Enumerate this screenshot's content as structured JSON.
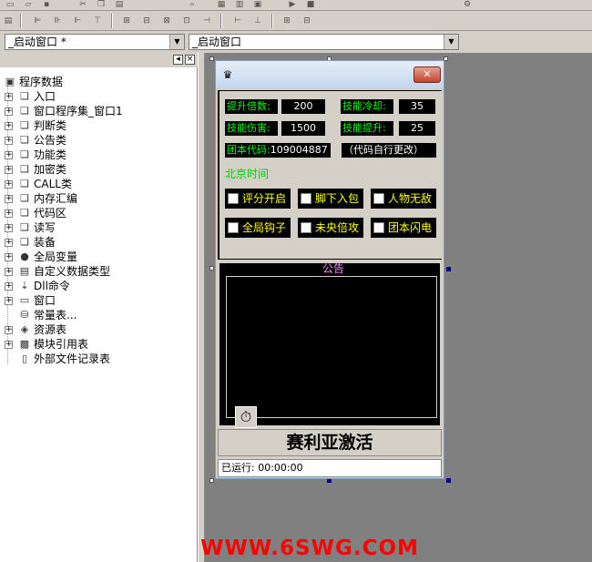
{
  "combo": {
    "left_value": "_启动窗口 *",
    "right_value": "_启动窗口"
  },
  "tree_panel": {
    "pin_glyph": "◂",
    "close_glyph": "×",
    "items": [
      {
        "label": "程序数据",
        "icon": "program-data-icon"
      },
      {
        "label": "入口",
        "icon": "book-icon"
      },
      {
        "label": "窗口程序集_窗口1",
        "icon": "book-icon"
      },
      {
        "label": "判断类",
        "icon": "book-icon"
      },
      {
        "label": "公告类",
        "icon": "book-icon"
      },
      {
        "label": "功能类",
        "icon": "book-icon"
      },
      {
        "label": "加密类",
        "icon": "book-icon"
      },
      {
        "label": "CALL类",
        "icon": "book-icon"
      },
      {
        "label": "内存汇编",
        "icon": "book-icon"
      },
      {
        "label": "代码区",
        "icon": "book-icon"
      },
      {
        "label": "读写",
        "icon": "book-icon"
      },
      {
        "label": "装备",
        "icon": "book-icon"
      },
      {
        "label": "全局变量",
        "icon": "global-var-icon"
      },
      {
        "label": "自定义数据类型",
        "icon": "datatype-icon"
      },
      {
        "label": "Dll命令",
        "icon": "dll-icon"
      },
      {
        "label": "窗口",
        "icon": "window-icon"
      },
      {
        "label": "常量表...",
        "icon": "constant-icon"
      },
      {
        "label": "资源表",
        "icon": "resource-icon"
      },
      {
        "label": "模块引用表",
        "icon": "module-icon"
      },
      {
        "label": "外部文件记录表",
        "icon": "file-record-icon"
      }
    ]
  },
  "form": {
    "close_glyph": "✕",
    "app_icon_glyph": "♛",
    "fields": {
      "boost_label": "提升倍数:",
      "boost_value": "200",
      "cooldown_label": "技能冷却:",
      "cooldown_value": "35",
      "damage_label": "技能伤害:",
      "damage_value": "1500",
      "skill_boost_label": "技能提升:",
      "skill_boost_value": "25",
      "team_code_label": "团本代码:",
      "team_code_value": "109004887",
      "team_code_note": "（代码自行更改）",
      "beijing_time": "北京时间"
    },
    "checkboxes": [
      "评分开启",
      "脚下入包",
      "人物无敌",
      "全局钩子",
      "未央倍攻",
      "团本闪电"
    ],
    "notice_title": "公告",
    "activate_label": "赛利亚激活",
    "status_text": "已运行: 00:00:00",
    "stopwatch_glyph": "⏱"
  },
  "watermark": "WWW.6SWG.COM",
  "colors": {
    "label_green": "#00ff00",
    "checkbox_yellow": "#ffff00",
    "notice_pink": "#ff80ff",
    "watermark_red": "#ff0000",
    "workspace_gray": "#808080",
    "window_face": "#d4d0c8"
  }
}
